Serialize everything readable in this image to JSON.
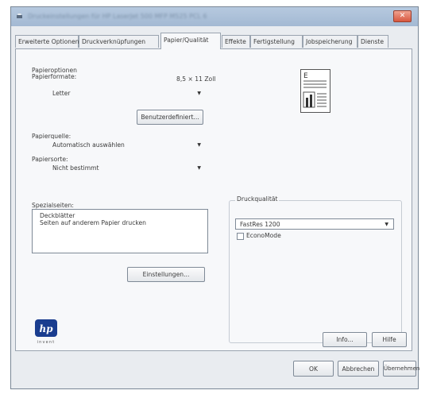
{
  "window": {
    "title": "Druckeinstellungen für HP LaserJet 500 MFP M525 PCL 6"
  },
  "tabs": [
    {
      "label": "Erweiterte Optionen",
      "active": false
    },
    {
      "label": "Druckverknüpfungen",
      "active": false
    },
    {
      "label": "Papier/Qualität",
      "active": true
    },
    {
      "label": "Effekte",
      "active": false
    },
    {
      "label": "Fertigstellung",
      "active": false
    },
    {
      "label": "Jobspeicherung",
      "active": false
    },
    {
      "label": "Dienste",
      "active": false
    }
  ],
  "paper_options": {
    "group_label": "Papieroptionen",
    "size_label": "Papierformate:",
    "size_readout": "8,5 × 11 Zoll",
    "size_value": "Letter",
    "custom_button": "Benutzerdefiniert...",
    "source_label": "Papierquelle:",
    "source_value": "Automatisch auswählen",
    "type_label": "Papiersorte:",
    "type_value": "Nicht bestimmt"
  },
  "special_pages": {
    "label": "Spezialseiten:",
    "items": [
      "Deckblätter",
      "Seiten auf anderem Papier drucken"
    ],
    "settings_button": "Einstellungen..."
  },
  "print_quality": {
    "group_label": "Druckqualität",
    "value": "FastRes 1200",
    "economode_label": "EconoMode",
    "economode_checked": false
  },
  "footer": {
    "info_button": "Info...",
    "help_button": "Hilfe",
    "ok_button": "OK",
    "cancel_button": "Abbrechen",
    "apply_button": "Übernehmen"
  },
  "logo": {
    "text": "hp",
    "tagline": "invent"
  },
  "colors": {
    "titlebar": "#a9bed8",
    "hp_blue": "#1a3d8f",
    "close_red": "#d7573f"
  }
}
